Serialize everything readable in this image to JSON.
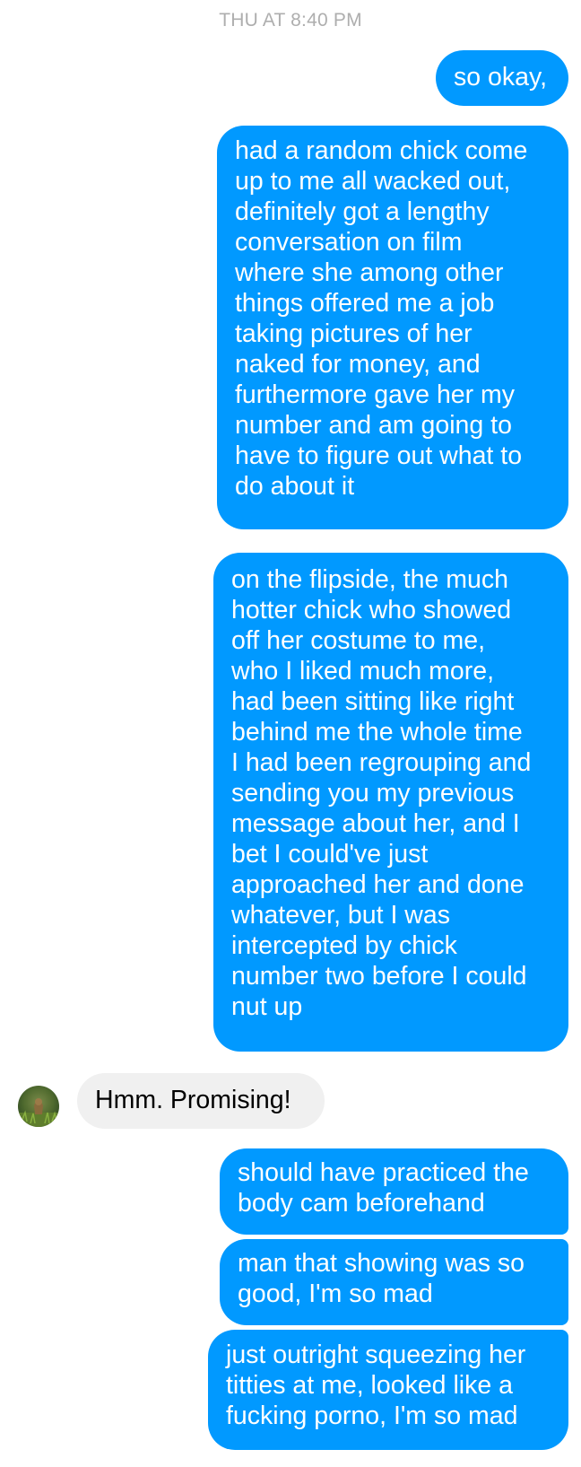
{
  "thread": {
    "timestamp": "THU AT 8:40 PM"
  },
  "messages": [
    {
      "direction": "out",
      "text": "so okay,"
    },
    {
      "direction": "out",
      "text": "had a random chick come\nup to me all wacked out,\ndefinitely got a lengthy\nconversation on film\nwhere she among other\nthings offered me a job\ntaking pictures of her\nnaked for money, and\nfurthermore gave her my\nnumber and am going to\nhave to figure out what to\ndo about it"
    },
    {
      "direction": "out",
      "text": "on the flipside, the much\nhotter chick who showed\noff her costume to me,\nwho I liked much more,\nhad been sitting like right\nbehind me the whole time\nI had been regrouping and\nsending you my previous\nmessage about her, and I\nbet I could've just\napproached her and done\nwhatever, but I was\nintercepted by chick\nnumber two before I could\nnut up"
    },
    {
      "direction": "in",
      "text": "Hmm. Promising!"
    },
    {
      "direction": "out",
      "text": "should have practiced the\nbody cam beforehand"
    },
    {
      "direction": "out",
      "text": "man that showing was so\ngood, I'm so mad"
    },
    {
      "direction": "out",
      "text": "just outright squeezing her\ntitties at me, looked like a\nfucking porno, I'm so mad"
    }
  ],
  "colors": {
    "outgoing_bubble": "#0199ff",
    "incoming_bubble": "#f0f0f0",
    "timestamp": "#aeaeae"
  },
  "contact": {
    "avatar_icon": "contact-avatar-photo"
  }
}
